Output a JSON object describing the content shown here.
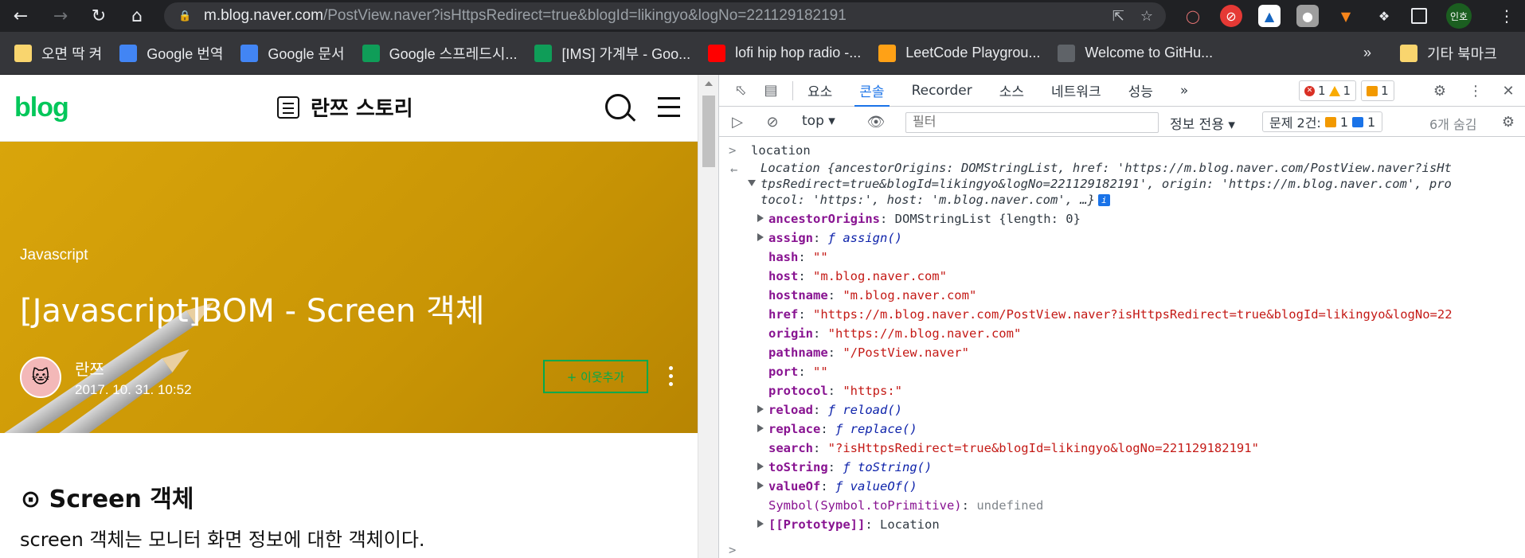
{
  "browser": {
    "url_host": "m.blog.naver.com",
    "url_path": "/PostView.naver?isHttpsRedirect=true&blogId=likingyo&logNo=221129182191",
    "profile_label": "인호"
  },
  "bookmarks": [
    {
      "label": "오면 딱 켜",
      "icon": "folder-icon",
      "color": "#f9d56e"
    },
    {
      "label": "Google 번역",
      "icon": "google-translate-icon",
      "color": "#4285f4"
    },
    {
      "label": "Google 문서",
      "icon": "google-docs-icon",
      "color": "#4285f4"
    },
    {
      "label": "Google 스프레드시...",
      "icon": "google-sheets-icon",
      "color": "#0f9d58"
    },
    {
      "label": "[IMS] 가계부 - Goo...",
      "icon": "google-sheets-icon",
      "color": "#0f9d58"
    },
    {
      "label": "lofi hip hop radio -...",
      "icon": "youtube-icon",
      "color": "#ff0000"
    },
    {
      "label": "LeetCode Playgrou...",
      "icon": "leetcode-icon",
      "color": "#ffa116"
    },
    {
      "label": "Welcome to GitHu...",
      "icon": "globe-icon",
      "color": "#5f6368"
    }
  ],
  "bookmarks_overflow": "»",
  "other_bookmarks": "기타 북마크",
  "blog": {
    "logo": "blog",
    "title": "란쯔 스토리",
    "category": "Javascript",
    "post_title": "[Javascript]BOM - Screen 객체",
    "author": "란쯔",
    "date": "2017. 10. 31. 10:52",
    "follow_label": "+ 이웃추가",
    "section_title": "⊙ Screen 객체",
    "section_text": "screen 객체는 모니터 화면 정보에 대한 객체이다."
  },
  "devtools": {
    "tabs": [
      "요소",
      "콘솔",
      "Recorder",
      "소스",
      "네트워크",
      "성능"
    ],
    "active_tab": "콘솔",
    "more_tabs": "»",
    "errors": "1",
    "warnings": "1",
    "issues": "1",
    "context": "top",
    "filter_placeholder": "필터",
    "level": "정보 전용",
    "issues_label": "문제 2건:",
    "issues_warn": "1",
    "issues_info": "1",
    "hidden": "6개 숨김"
  },
  "console": {
    "input": "location",
    "summary_1": "Location {ancestorOrigins: DOMStringList, href: 'https://m.blog.naver.com/PostView.naver?isHt",
    "summary_2": "tpsRedirect=true&blogId=likingyo&logNo=221129182191', origin: 'https://m.blog.naver.com', pro",
    "summary_3": "tocol: 'https:', host: 'm.blog.naver.com', …}",
    "props": [
      {
        "key": "ancestorOrigins",
        "val": "DOMStringList {length: 0}",
        "type": "obj",
        "expand": true
      },
      {
        "key": "assign",
        "val": "ƒ assign()",
        "type": "fn",
        "expand": true
      },
      {
        "key": "hash",
        "val": "\"\"",
        "type": "str",
        "expand": false
      },
      {
        "key": "host",
        "val": "\"m.blog.naver.com\"",
        "type": "str",
        "expand": false
      },
      {
        "key": "hostname",
        "val": "\"m.blog.naver.com\"",
        "type": "str",
        "expand": false
      },
      {
        "key": "href",
        "val": "\"https://m.blog.naver.com/PostView.naver?isHttpsRedirect=true&blogId=likingyo&logNo=22",
        "type": "str",
        "expand": false
      },
      {
        "key": "origin",
        "val": "\"https://m.blog.naver.com\"",
        "type": "str",
        "expand": false
      },
      {
        "key": "pathname",
        "val": "\"/PostView.naver\"",
        "type": "str",
        "expand": false
      },
      {
        "key": "port",
        "val": "\"\"",
        "type": "str",
        "expand": false
      },
      {
        "key": "protocol",
        "val": "\"https:\"",
        "type": "str",
        "expand": false
      },
      {
        "key": "reload",
        "val": "ƒ reload()",
        "type": "fn",
        "expand": true
      },
      {
        "key": "replace",
        "val": "ƒ replace()",
        "type": "fn",
        "expand": true
      },
      {
        "key": "search",
        "val": "\"?isHttpsRedirect=true&blogId=likingyo&logNo=221129182191\"",
        "type": "str",
        "expand": false
      },
      {
        "key": "toString",
        "val": "ƒ toString()",
        "type": "fn",
        "expand": true
      },
      {
        "key": "valueOf",
        "val": "ƒ valueOf()",
        "type": "fn",
        "expand": true
      },
      {
        "key": "Symbol(Symbol.toPrimitive)",
        "val": "undefined",
        "type": "undef",
        "expand": false
      },
      {
        "key": "[[Prototype]]",
        "val": "Location",
        "type": "proto",
        "expand": true
      }
    ]
  }
}
